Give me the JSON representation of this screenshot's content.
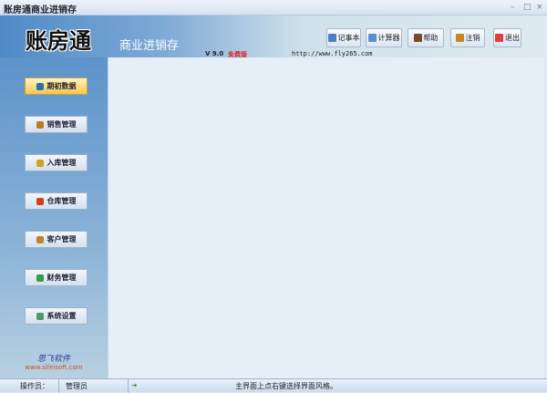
{
  "window": {
    "title": "账房通商业进销存",
    "minimize": "–",
    "maximize": "□",
    "close": "×"
  },
  "header": {
    "logo": "账房通",
    "subtitle": "商业进销存",
    "version": "V 9.0",
    "edition": "免费版",
    "url": "http://www.fly265.com",
    "buttons": [
      {
        "label": "记事本",
        "icon": "notepad-icon",
        "color": "#4a7fc0"
      },
      {
        "label": "计算器",
        "icon": "calculator-icon",
        "color": "#5a8fd0"
      },
      {
        "label": "帮助",
        "icon": "help-icon",
        "color": "#7a4a2a"
      },
      {
        "label": "注销",
        "icon": "logout-icon",
        "color": "#c08a20"
      },
      {
        "label": "退出",
        "icon": "exit-icon",
        "color": "#e04040"
      }
    ]
  },
  "sidebar": {
    "items": [
      {
        "label": "期初数据",
        "icon": "book-icon",
        "color": "#2a70b0",
        "active": true
      },
      {
        "label": "销售管理",
        "icon": "sales-icon",
        "color": "#c07a20"
      },
      {
        "label": "入库管理",
        "icon": "stock-in-icon",
        "color": "#d0a020"
      },
      {
        "label": "仓库管理",
        "icon": "warehouse-icon",
        "color": "#d04020"
      },
      {
        "label": "客户管理",
        "icon": "customer-icon",
        "color": "#c08030"
      },
      {
        "label": "财务管理",
        "icon": "finance-icon",
        "color": "#30a040"
      },
      {
        "label": "系统设置",
        "icon": "settings-icon",
        "color": "#4a9a6a"
      }
    ],
    "brand_name": "思飞软件",
    "brand_url": "www.sifeisoft.com"
  },
  "status": {
    "operator_label": "操作员：",
    "operator": "管理员",
    "message": "主界面上点右键选择界面风格。"
  }
}
